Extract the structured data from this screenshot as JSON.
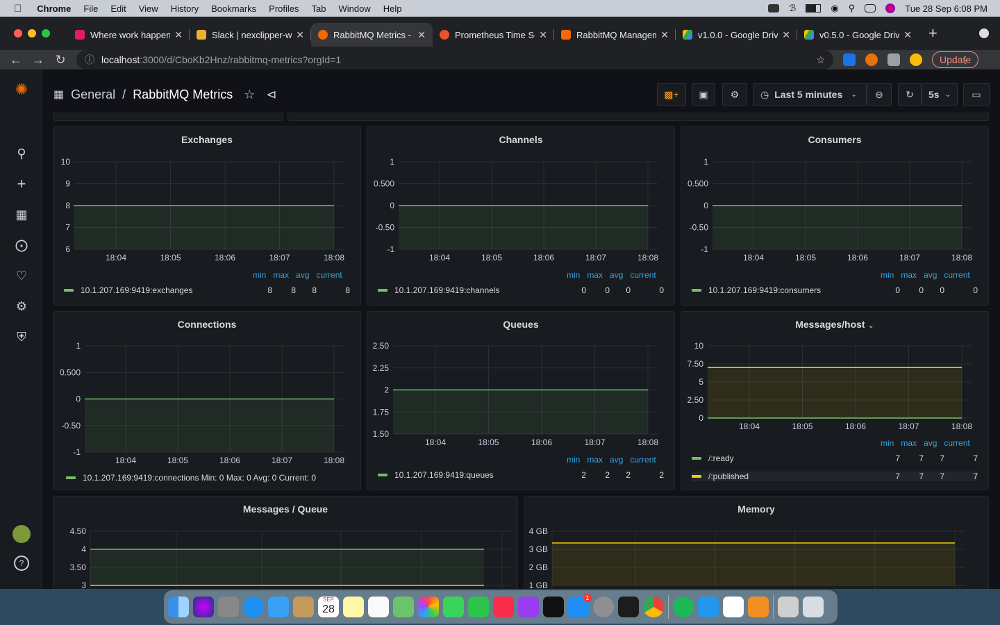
{
  "menubar": {
    "app": "Chrome",
    "items": [
      "File",
      "Edit",
      "View",
      "History",
      "Bookmarks",
      "Profiles",
      "Tab",
      "Window",
      "Help"
    ],
    "clock": "Tue 28 Sep  6:08 PM"
  },
  "tabs": [
    {
      "title": "Where work happens",
      "color": "#e01e5a"
    },
    {
      "title": "Slack | nexclipper-w",
      "color": "#ecb22e"
    },
    {
      "title": "RabbitMQ Metrics - G",
      "color": "#f46800",
      "active": true
    },
    {
      "title": "Prometheus Time Se",
      "color": "#e6522c"
    },
    {
      "title": "RabbitMQ Managem",
      "color": "#ff6600"
    },
    {
      "title": "v1.0.0 - Google Driv",
      "color": "#34a853"
    },
    {
      "title": "v0.5.0 - Google Driv",
      "color": "#34a853"
    }
  ],
  "address": {
    "host": "localhost",
    "path": ":3000/d/CboKb2Hnz/rabbitmq-metrics?orgId=1"
  },
  "update_label": "Update",
  "dashboard": {
    "folder": "General",
    "title": "RabbitMQ Metrics",
    "time_range": "Last 5 minutes",
    "refresh": "5s"
  },
  "legend_labels": {
    "min": "min",
    "max": "max",
    "avg": "avg",
    "current": "current"
  },
  "panels": {
    "exchanges": {
      "title": "Exchanges",
      "yticks": [
        "10",
        "9",
        "8",
        "7",
        "6"
      ],
      "xticks": [
        "18:04",
        "18:05",
        "18:06",
        "18:07",
        "18:08"
      ],
      "series": [
        {
          "name": "10.1.207.169:9419:exchanges",
          "color": "#73bf69",
          "min": "8",
          "max": "8",
          "avg": "8",
          "current": "8"
        }
      ],
      "chart_data": {
        "type": "line",
        "x": [
          "18:04",
          "18:05",
          "18:06",
          "18:07",
          "18:08"
        ],
        "series": [
          {
            "name": "10.1.207.169:9419:exchanges",
            "values": [
              8,
              8,
              8,
              8,
              8
            ]
          }
        ],
        "ylim": [
          6,
          10
        ]
      }
    },
    "channels": {
      "title": "Channels",
      "yticks": [
        "1",
        "0.500",
        "0",
        "-0.50",
        "-1"
      ],
      "xticks": [
        "18:04",
        "18:05",
        "18:06",
        "18:07",
        "18:08"
      ],
      "series": [
        {
          "name": "10.1.207.169:9419:channels",
          "color": "#73bf69",
          "min": "0",
          "max": "0",
          "avg": "0",
          "current": "0"
        }
      ],
      "chart_data": {
        "type": "line",
        "x": [
          "18:04",
          "18:05",
          "18:06",
          "18:07",
          "18:08"
        ],
        "series": [
          {
            "name": "10.1.207.169:9419:channels",
            "values": [
              0,
              0,
              0,
              0,
              0
            ]
          }
        ],
        "ylim": [
          -1,
          1
        ]
      }
    },
    "consumers": {
      "title": "Consumers",
      "yticks": [
        "1",
        "0.500",
        "0",
        "-0.50",
        "-1"
      ],
      "xticks": [
        "18:04",
        "18:05",
        "18:06",
        "18:07",
        "18:08"
      ],
      "series": [
        {
          "name": "10.1.207.169:9419:consumers",
          "color": "#73bf69",
          "min": "0",
          "max": "0",
          "avg": "0",
          "current": "0"
        }
      ],
      "chart_data": {
        "type": "line",
        "x": [
          "18:04",
          "18:05",
          "18:06",
          "18:07",
          "18:08"
        ],
        "series": [
          {
            "name": "10.1.207.169:9419:consumers",
            "values": [
              0,
              0,
              0,
              0,
              0
            ]
          }
        ],
        "ylim": [
          -1,
          1
        ]
      }
    },
    "connections": {
      "title": "Connections",
      "yticks": [
        "1",
        "0.500",
        "0",
        "-0.50",
        "-1"
      ],
      "xticks": [
        "18:04",
        "18:05",
        "18:06",
        "18:07",
        "18:08"
      ],
      "legend_text": "10.1.207.169:9419:connections  Min: 0  Max: 0  Avg: 0  Current: 0",
      "chart_data": {
        "type": "line",
        "x": [
          "18:04",
          "18:05",
          "18:06",
          "18:07",
          "18:08"
        ],
        "series": [
          {
            "name": "10.1.207.169:9419:connections",
            "values": [
              0,
              0,
              0,
              0,
              0
            ]
          }
        ],
        "ylim": [
          -1,
          1
        ]
      }
    },
    "queues": {
      "title": "Queues",
      "yticks": [
        "2.50",
        "2.25",
        "2",
        "1.75",
        "1.50"
      ],
      "xticks": [
        "18:04",
        "18:05",
        "18:06",
        "18:07",
        "18:08"
      ],
      "series": [
        {
          "name": "10.1.207.169:9419:queues",
          "color": "#73bf69",
          "min": "2",
          "max": "2",
          "avg": "2",
          "current": "2"
        }
      ],
      "chart_data": {
        "type": "line",
        "x": [
          "18:04",
          "18:05",
          "18:06",
          "18:07",
          "18:08"
        ],
        "series": [
          {
            "name": "10.1.207.169:9419:queues",
            "values": [
              2,
              2,
              2,
              2,
              2
            ]
          }
        ],
        "ylim": [
          1.5,
          2.5
        ]
      }
    },
    "messages_host": {
      "title": "Messages/host",
      "yticks": [
        "10",
        "7.50",
        "5",
        "2.50",
        "0"
      ],
      "xticks": [
        "18:04",
        "18:05",
        "18:06",
        "18:07",
        "18:08"
      ],
      "series": [
        {
          "name": "/:ready",
          "color": "#73bf69",
          "min": "7",
          "max": "7",
          "avg": "7",
          "current": "7"
        },
        {
          "name": "/:published",
          "color": "#f2cc0c",
          "min": "7",
          "max": "7",
          "avg": "7",
          "current": "7"
        }
      ],
      "chart_data": {
        "type": "line",
        "x": [
          "18:04",
          "18:05",
          "18:06",
          "18:07",
          "18:08"
        ],
        "series": [
          {
            "name": "/:ready",
            "values": [
              0,
              0,
              0,
              0,
              0
            ]
          },
          {
            "name": "/:published",
            "values": [
              7,
              7,
              7,
              7,
              7
            ]
          }
        ],
        "ylim": [
          0,
          10
        ]
      }
    },
    "messages_queue": {
      "title": "Messages / Queue",
      "yticks": [
        "4.50",
        "4",
        "3.50",
        "3"
      ],
      "chart_data": {
        "type": "line",
        "series": [
          {
            "values": [
              4,
              4,
              4,
              4,
              4
            ]
          },
          {
            "values": [
              3,
              3,
              3,
              3,
              3
            ]
          }
        ],
        "ylim": [
          3,
          4.5
        ]
      }
    },
    "memory": {
      "title": "Memory",
      "yticks": [
        "4 GB",
        "3 GB",
        "2 GB",
        "1 GB"
      ],
      "chart_data": {
        "type": "line",
        "series": [
          {
            "values": [
              3.35,
              3.35,
              3.35,
              3.35,
              3.35
            ]
          }
        ],
        "ylim": [
          1,
          4
        ]
      }
    }
  },
  "dock": {
    "cal_month": "SEP",
    "cal_day": "28",
    "badge": "1"
  }
}
